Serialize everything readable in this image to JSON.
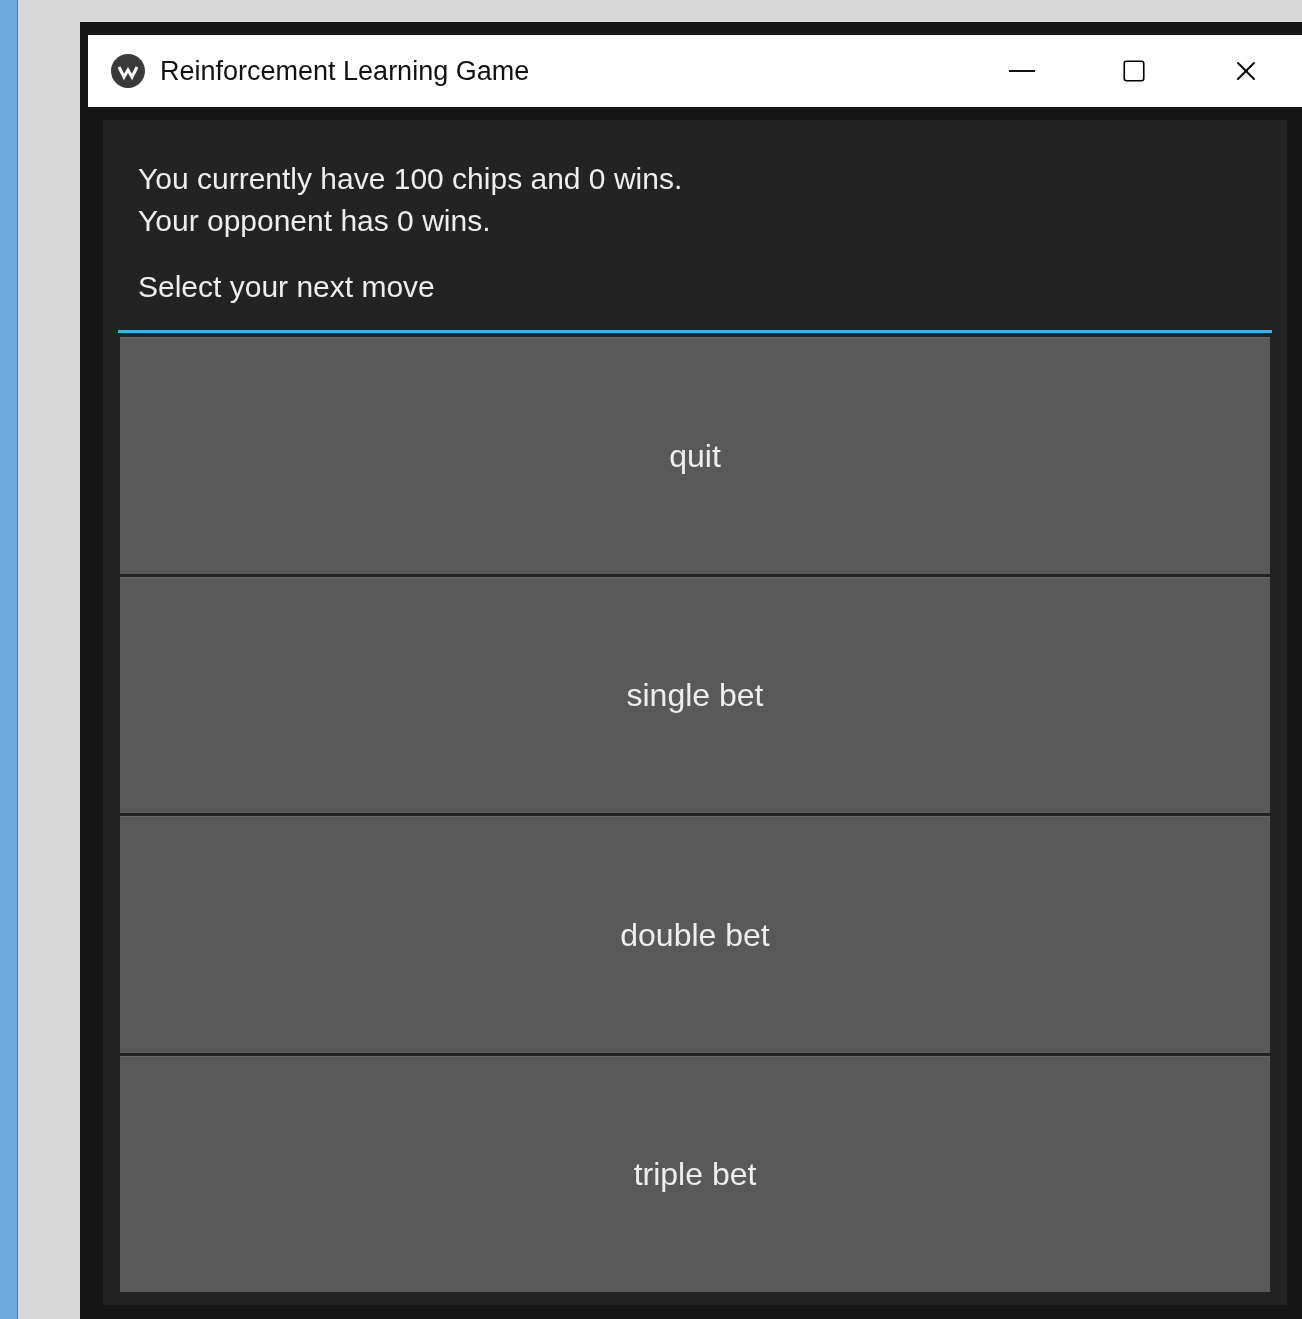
{
  "window": {
    "title": "Reinforcement Learning Game"
  },
  "status_lines": [
    "You currently have 100 chips and 0 wins.",
    "Your opponent has 0 wins."
  ],
  "prompt": "Select your next move",
  "buttons": [
    "quit",
    "single bet",
    "double bet",
    "triple bet"
  ]
}
